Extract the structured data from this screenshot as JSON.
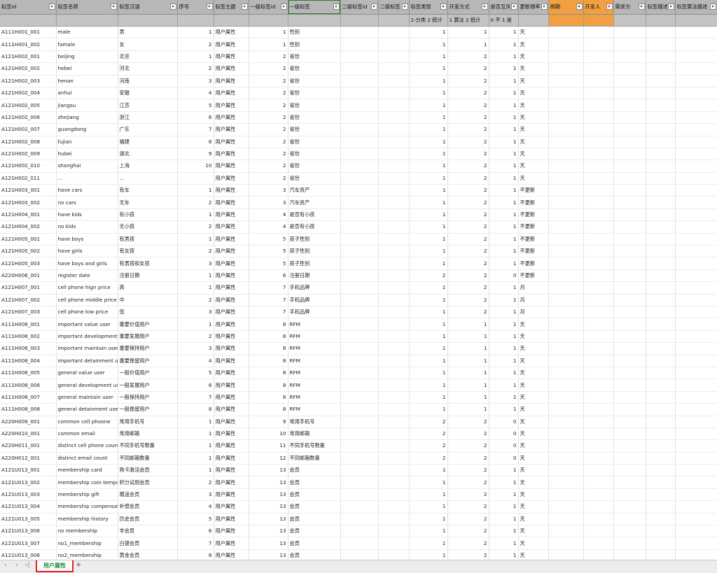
{
  "headers": [
    {
      "label": "标签id"
    },
    {
      "label": "标签名称"
    },
    {
      "label": "标签汉语"
    },
    {
      "label": "序号"
    },
    {
      "label": "标签主题"
    },
    {
      "label": "一级标签id"
    },
    {
      "label": "一级标签",
      "selected": true
    },
    {
      "label": "二级标签id"
    },
    {
      "label": "二级标签"
    },
    {
      "label": "标签类型"
    },
    {
      "label": "开发方式"
    },
    {
      "label": "是否互斥"
    },
    {
      "label": "更新频率"
    },
    {
      "label": "排期",
      "orange": true
    },
    {
      "label": "开发人",
      "orange": true
    },
    {
      "label": "需求方"
    },
    {
      "label": "标签描述"
    },
    {
      "label": "标签算法描述"
    }
  ],
  "subheader": {
    "type": "1-分类 2 统计",
    "dev": "1 算法 2 统计",
    "excl": "0 不 1 是"
  },
  "rows": [
    [
      "A111H001_001",
      "male",
      "男",
      "1",
      "用户属性",
      "1",
      "性别",
      "1",
      "1",
      "1",
      "天"
    ],
    [
      "A111H001_002",
      "famale",
      "女",
      "2",
      "用户属性",
      "1",
      "性别",
      "1",
      "1",
      "1",
      "天"
    ],
    [
      "A121H002_001",
      "beijing",
      "北京",
      "1",
      "用户属性",
      "2",
      "省份",
      "1",
      "2",
      "1",
      "天"
    ],
    [
      "A121H002_002",
      "hebei",
      "河北",
      "2",
      "用户属性",
      "2",
      "省份",
      "1",
      "2",
      "1",
      "天"
    ],
    [
      "A121H002_003",
      "henan",
      "河南",
      "3",
      "用户属性",
      "2",
      "省份",
      "1",
      "2",
      "1",
      "天"
    ],
    [
      "A121H002_004",
      "anhui",
      "安徽",
      "4",
      "用户属性",
      "2",
      "省份",
      "1",
      "2",
      "1",
      "天"
    ],
    [
      "A121H002_005",
      "jiangsu",
      "江苏",
      "5",
      "用户属性",
      "2",
      "省份",
      "1",
      "2",
      "1",
      "天"
    ],
    [
      "A121H002_006",
      "zhejiang",
      "浙江",
      "6",
      "用户属性",
      "2",
      "省份",
      "1",
      "2",
      "1",
      "天"
    ],
    [
      "A121H002_007",
      "guangdong",
      "广东",
      "7",
      "用户属性",
      "2",
      "省份",
      "1",
      "2",
      "1",
      "天"
    ],
    [
      "A121H002_008",
      "fujian",
      "福建",
      "8",
      "用户属性",
      "2",
      "省份",
      "1",
      "2",
      "1",
      "天"
    ],
    [
      "A121H002_009",
      "hubei",
      "湖北",
      "9",
      "用户属性",
      "2",
      "省份",
      "1",
      "2",
      "1",
      "天"
    ],
    [
      "A121H002_010",
      "shanghai",
      "上海",
      "10",
      "用户属性",
      "2",
      "省份",
      "1",
      "2",
      "1",
      "天"
    ],
    [
      "A121H002_011",
      "…",
      "…",
      "",
      "用户属性",
      "2",
      "省份",
      "1",
      "2",
      "1",
      "天"
    ],
    [
      "A121H003_001",
      "have cars",
      "有车",
      "1",
      "用户属性",
      "3",
      "汽车资产",
      "1",
      "2",
      "1",
      "不更新"
    ],
    [
      "A121H003_002",
      "no cars",
      "无车",
      "2",
      "用户属性",
      "3",
      "汽车资产",
      "1",
      "2",
      "1",
      "不更新"
    ],
    [
      "A121H004_001",
      "have kids",
      "有小孩",
      "1",
      "用户属性",
      "4",
      "是否有小孩",
      "1",
      "2",
      "1",
      "不更新"
    ],
    [
      "A121H004_002",
      "no kids",
      "无小孩",
      "2",
      "用户属性",
      "4",
      "是否有小孩",
      "1",
      "2",
      "1",
      "不更新"
    ],
    [
      "A121H005_001",
      "have boys",
      "有男孩",
      "1",
      "用户属性",
      "5",
      "孩子性别",
      "1",
      "2",
      "1",
      "不更新"
    ],
    [
      "A121H005_002",
      "have girls",
      "有女孩",
      "2",
      "用户属性",
      "5",
      "孩子性别",
      "1",
      "2",
      "1",
      "不更新"
    ],
    [
      "A121H005_003",
      "have boys and girls",
      "有男孩和女孩",
      "3",
      "用户属性",
      "5",
      "孩子性别",
      "1",
      "2",
      "1",
      "不更新"
    ],
    [
      "A220H006_001",
      "register date",
      "注册日期",
      "1",
      "用户属性",
      "6",
      "注册日期",
      "2",
      "2",
      "0",
      "不更新"
    ],
    [
      "A121H007_001",
      "cell phone hign price",
      "高",
      "1",
      "用户属性",
      "7",
      "手机品牌",
      "1",
      "2",
      "1",
      "月"
    ],
    [
      "A121H007_002",
      "cell phone middle price",
      "中",
      "2",
      "用户属性",
      "7",
      "手机品牌",
      "1",
      "2",
      "1",
      "月"
    ],
    [
      "A121H007_003",
      "cell phone low price",
      "低",
      "3",
      "用户属性",
      "7",
      "手机品牌",
      "1",
      "2",
      "1",
      "月"
    ],
    [
      "A111H008_001",
      "important value user",
      "重要价值用户",
      "1",
      "用户属性",
      "8",
      "RFM",
      "1",
      "1",
      "1",
      "天"
    ],
    [
      "A111H008_002",
      "important development user",
      "重要发展用户",
      "2",
      "用户属性",
      "8",
      "RFM",
      "1",
      "1",
      "1",
      "天"
    ],
    [
      "A111H008_003",
      "important maintain user",
      "重要保持用户",
      "3",
      "用户属性",
      "8",
      "RFM",
      "1",
      "1",
      "1",
      "天"
    ],
    [
      "A111H008_004",
      "important detainment user",
      "重要挽留用户",
      "4",
      "用户属性",
      "8",
      "RFM",
      "1",
      "1",
      "1",
      "天"
    ],
    [
      "A111H008_005",
      "general value user",
      "一般价值用户",
      "5",
      "用户属性",
      "8",
      "RFM",
      "1",
      "1",
      "1",
      "天"
    ],
    [
      "A111H008_006",
      "general development user",
      "一般发展用户",
      "6",
      "用户属性",
      "8",
      "RFM",
      "1",
      "1",
      "1",
      "天"
    ],
    [
      "A111H008_007",
      "general maintain user",
      "一般保持用户",
      "7",
      "用户属性",
      "8",
      "RFM",
      "1",
      "1",
      "1",
      "天"
    ],
    [
      "A111H008_008",
      "general detainment user",
      "一般挽留用户",
      "8",
      "用户属性",
      "8",
      "RFM",
      "1",
      "1",
      "1",
      "天"
    ],
    [
      "A220H009_001",
      "common cell phoone",
      "常用手机号",
      "1",
      "用户属性",
      "9",
      "常用手机号",
      "2",
      "2",
      "0",
      "天"
    ],
    [
      "A220H010_001",
      "common email",
      "常用邮箱",
      "1",
      "用户属性",
      "10",
      "常用邮箱",
      "2",
      "2",
      "0",
      "天"
    ],
    [
      "A220H011_001",
      "distinct cell phone count",
      "不同手机号数量",
      "1",
      "用户属性",
      "11",
      "不同手机号数量",
      "2",
      "2",
      "0",
      "天"
    ],
    [
      "A220H012_001",
      "distinct email count",
      "不同邮箱数量",
      "1",
      "用户属性",
      "12",
      "不同邮箱数量",
      "2",
      "2",
      "0",
      "天"
    ],
    [
      "A121U013_001",
      "membership card",
      "购卡激活会员",
      "1",
      "用户属性",
      "13",
      "会员",
      "1",
      "2",
      "1",
      "天"
    ],
    [
      "A121U013_002",
      "membership coin temporary",
      "积分试用会员",
      "2",
      "用户属性",
      "13",
      "会员",
      "1",
      "2",
      "1",
      "天"
    ],
    [
      "A121U013_003",
      "membership gift",
      "赠送会员",
      "3",
      "用户属性",
      "13",
      "会员",
      "1",
      "2",
      "1",
      "天"
    ],
    [
      "A121U013_004",
      "membership compensate",
      "补偿会员",
      "4",
      "用户属性",
      "13",
      "会员",
      "1",
      "2",
      "1",
      "天"
    ],
    [
      "A121U013_005",
      "membership history",
      "历史会员",
      "5",
      "用户属性",
      "13",
      "会员",
      "1",
      "2",
      "1",
      "天"
    ],
    [
      "A121U013_006",
      "no membership",
      "非会员",
      "6",
      "用户属性",
      "13",
      "会员",
      "1",
      "2",
      "1",
      "天"
    ],
    [
      "A121U013_007",
      "no1_membership",
      "白银会员",
      "7",
      "用户属性",
      "13",
      "会员",
      "1",
      "2",
      "1",
      "天"
    ],
    [
      "A121U013_008",
      "no2_membership",
      "黄金会员",
      "8",
      "用户属性",
      "13",
      "会员",
      "1",
      "2",
      "1",
      "天"
    ]
  ],
  "sheet_tab": "用户属性",
  "nav_icons": [
    "first-sheet-icon",
    "prev-sheet-icon",
    "next-sheet-icon",
    "last-sheet-icon"
  ]
}
